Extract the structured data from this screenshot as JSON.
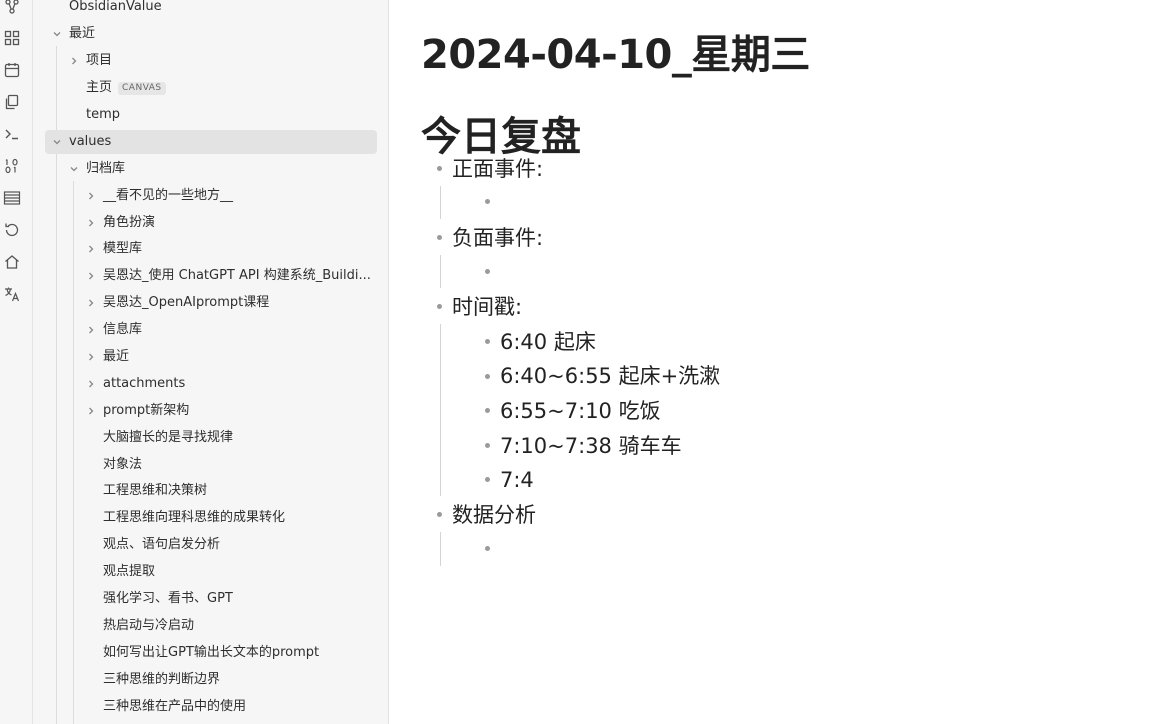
{
  "ribbon": {
    "icons": [
      "graph-icon",
      "dashboard-icon",
      "calendar-icon",
      "copy-icon",
      "terminal-icon",
      "binary-icon",
      "slides-icon",
      "history-icon",
      "home-icon",
      "translate-icon"
    ]
  },
  "sidebar": {
    "items": [
      {
        "label": "ObsidianValue"
      },
      {
        "label": "最近"
      },
      {
        "label": "项目"
      },
      {
        "label": "主页",
        "badge": "CANVAS"
      },
      {
        "label": "temp"
      },
      {
        "label": "values"
      },
      {
        "label": "归档库"
      },
      {
        "label": "__看不见的一些地方__"
      },
      {
        "label": "角色扮演"
      },
      {
        "label": "模型库"
      },
      {
        "label": "吴恩达_使用 ChatGPT API 构建系统_Buildi..."
      },
      {
        "label": "吴恩达_OpenAIprompt课程"
      },
      {
        "label": "信息库"
      },
      {
        "label": "最近"
      },
      {
        "label": "attachments"
      },
      {
        "label": "prompt新架构"
      },
      {
        "label": "大脑擅长的是寻找规律"
      },
      {
        "label": "对象法"
      },
      {
        "label": "工程思维和决策树"
      },
      {
        "label": "工程思维向理科思维的成果转化"
      },
      {
        "label": "观点、语句启发分析"
      },
      {
        "label": "观点提取"
      },
      {
        "label": "强化学习、看书、GPT"
      },
      {
        "label": "热启动与冷启动"
      },
      {
        "label": "如何写出让GPT输出长文本的prompt"
      },
      {
        "label": "三种思维的判断边界"
      },
      {
        "label": "三种思维在产品中的使用"
      }
    ]
  },
  "editor": {
    "title": "2024-04-10_星期三",
    "heading": "今日复盘",
    "sections": [
      {
        "label": "正面事件:",
        "children": [
          ""
        ]
      },
      {
        "label": "负面事件:",
        "children": [
          ""
        ]
      },
      {
        "label": "时间戳:",
        "children": [
          "6:40 起床",
          "6:40~6:55 起床+洗漱",
          "6:55~7:10 吃饭",
          "7:10~7:38 骑车车",
          "7:4"
        ]
      },
      {
        "label": "数据分析",
        "children": [
          ""
        ]
      }
    ]
  }
}
